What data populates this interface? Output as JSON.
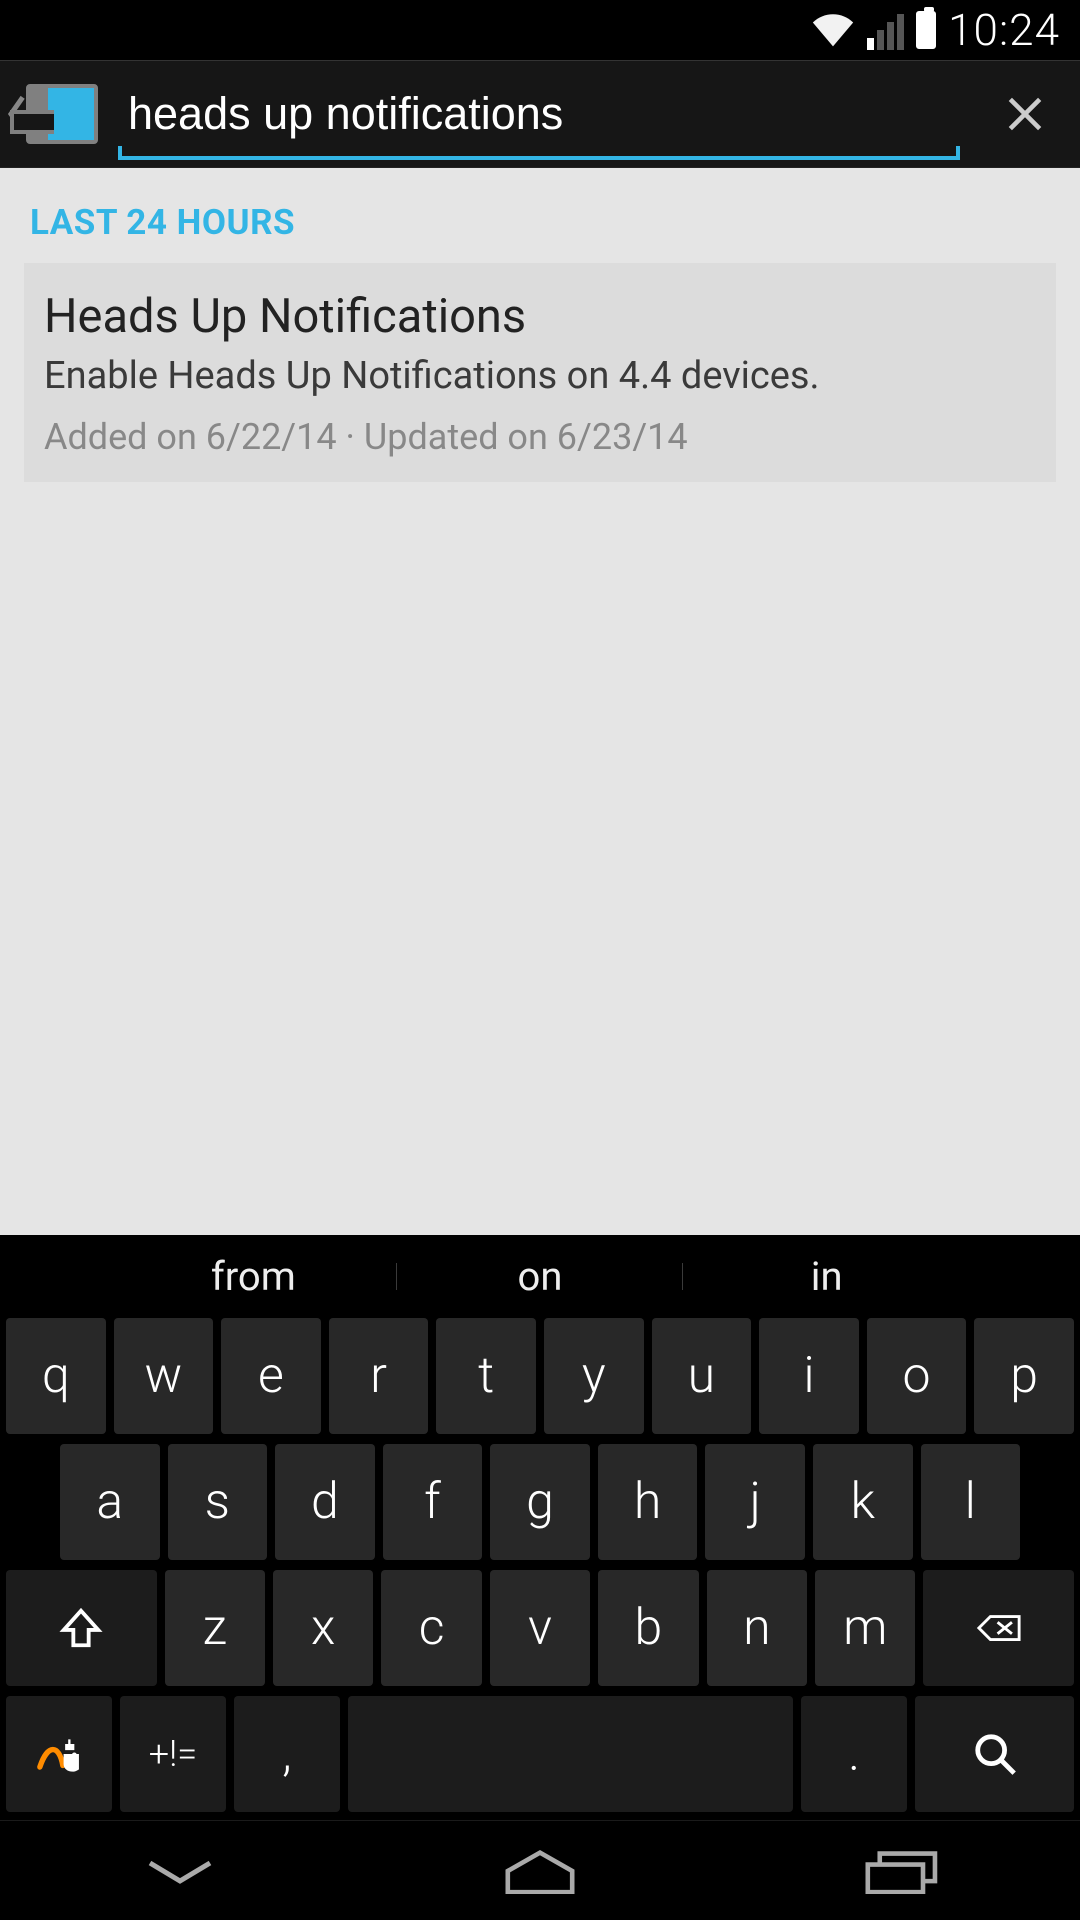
{
  "status": {
    "time": "10:24"
  },
  "search": {
    "value": "heads up notifications"
  },
  "section": {
    "header": "LAST 24 HOURS"
  },
  "results": [
    {
      "title": "Heads Up Notifications",
      "description": "Enable Heads Up Notifications on 4.4 devices.",
      "meta": "Added on 6/22/14 · Updated on 6/23/14"
    }
  ],
  "keyboard": {
    "suggestions": [
      "from",
      "on",
      "in"
    ],
    "row1": [
      "q",
      "w",
      "e",
      "r",
      "t",
      "y",
      "u",
      "i",
      "o",
      "p"
    ],
    "row2": [
      "a",
      "s",
      "d",
      "f",
      "g",
      "h",
      "j",
      "k",
      "l"
    ],
    "row3": [
      "z",
      "x",
      "c",
      "v",
      "b",
      "n",
      "m"
    ],
    "symkey": "+!=",
    "comma": ",",
    "period": "."
  }
}
